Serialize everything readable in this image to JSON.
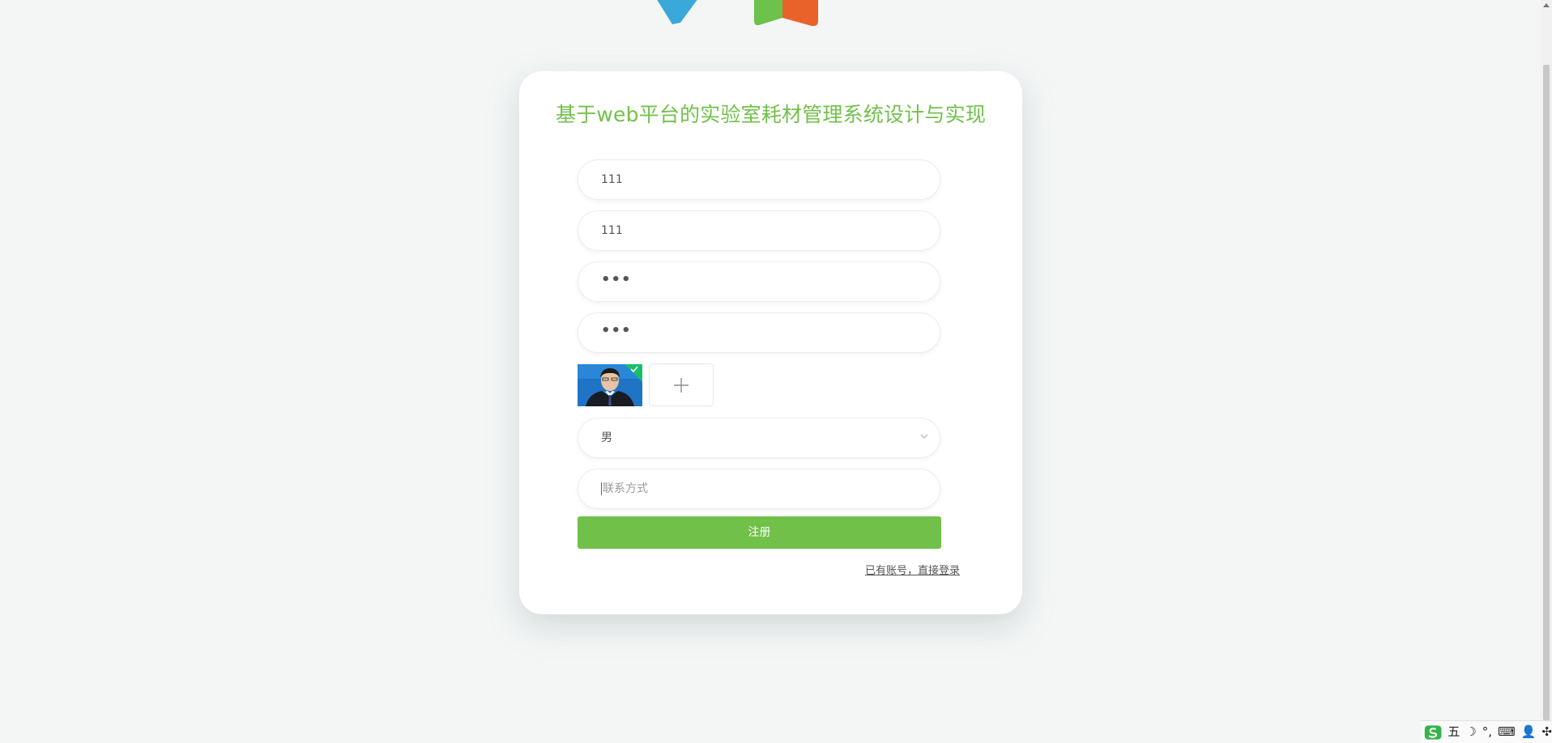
{
  "page": {
    "title": "基于web平台的实验室耗材管理系统设计与实现"
  },
  "form": {
    "account_value": "111",
    "name_value": "111",
    "password_mask": "•••",
    "confirm_password_mask": "•••",
    "gender_selected": "男",
    "contact_placeholder": "联系方式",
    "register_label": "注册",
    "login_link_label": "已有账号，直接登录"
  },
  "ime": {
    "mode_label": "五",
    "moon_label": "☽",
    "punct_label": "°,",
    "keyboard_label": "⌨",
    "user_label": "👤",
    "grid_label": "✣"
  },
  "colors": {
    "accent": "#71c04a",
    "title": "#72c14b",
    "logo_blue": "#3aa8d8",
    "logo_green": "#6cc24a",
    "logo_orange": "#e8622a"
  }
}
